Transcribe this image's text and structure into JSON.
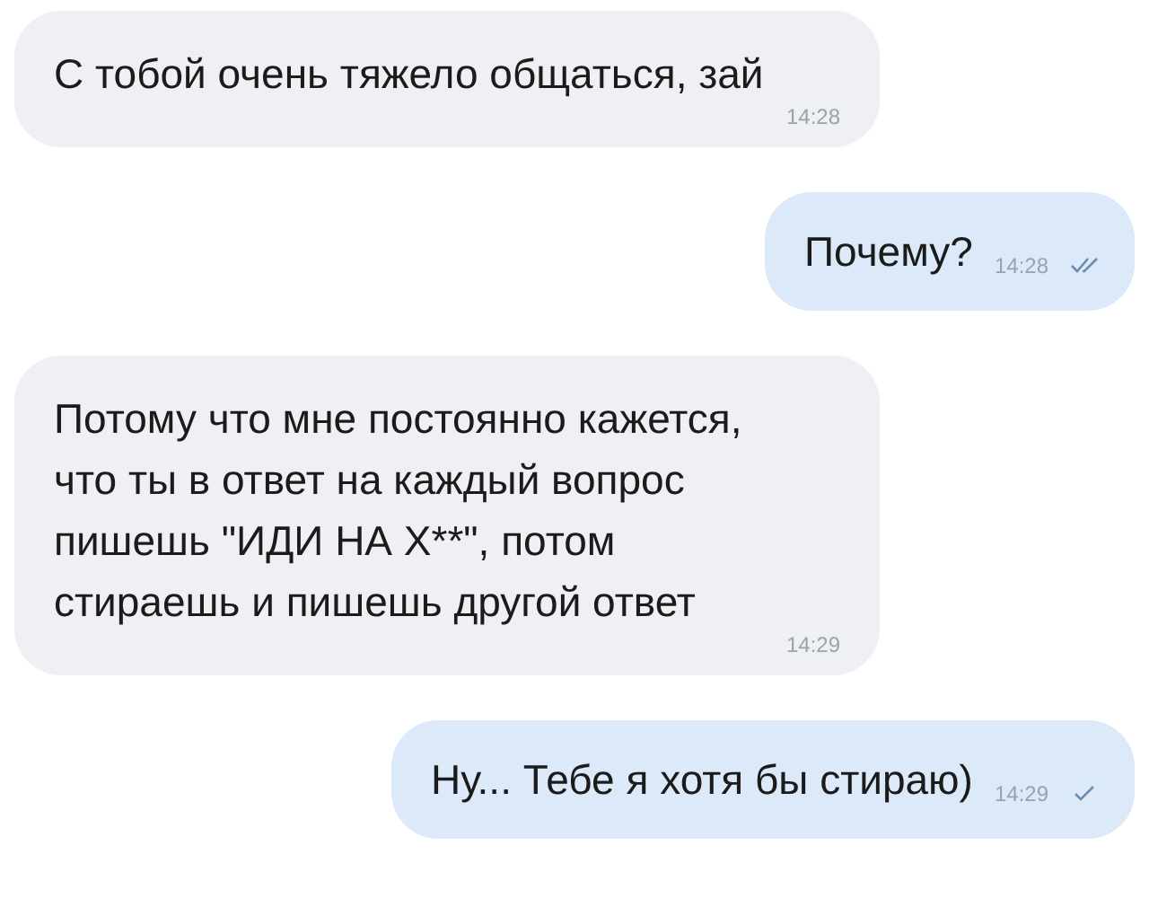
{
  "messages": [
    {
      "kind": "incoming",
      "text": "С тобой очень тяжело общаться, зай",
      "time": "14:28"
    },
    {
      "kind": "outgoing",
      "text": "Почему?",
      "time": "14:28",
      "read": true
    },
    {
      "kind": "incoming",
      "text": "Потому что мне постоянно кажется, что ты в ответ на каждый вопрос пишешь \"ИДИ НА Х**\", потом стираешь и пишешь другой ответ",
      "time": "14:29"
    },
    {
      "kind": "outgoing",
      "text": "Ну... Тебе я хотя бы стираю)",
      "time": "14:29",
      "read": false
    }
  ]
}
